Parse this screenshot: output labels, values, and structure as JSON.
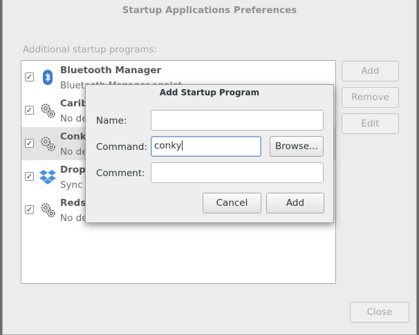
{
  "window": {
    "title": "Startup Applications Preferences",
    "section_label": "Additional startup programs:",
    "buttons": {
      "add": "Add",
      "remove": "Remove",
      "edit": "Edit",
      "close": "Close"
    }
  },
  "programs": [
    {
      "name": "Bluetooth Manager",
      "description": "Bluetooth Manager applet",
      "checked": true,
      "icon": "bluetooth-icon"
    },
    {
      "name": "Caribou",
      "description": "No description",
      "checked": true,
      "icon": "gears-icon"
    },
    {
      "name": "Conky",
      "description": "No description",
      "checked": true,
      "icon": "gears-icon",
      "selected": true
    },
    {
      "name": "Dropbox",
      "description": "Sync your files",
      "checked": true,
      "icon": "dropbox-icon"
    },
    {
      "name": "Redshift",
      "description": "No description",
      "checked": true,
      "icon": "gears-icon"
    }
  ],
  "dialog": {
    "title": "Add Startup Program",
    "name_label": "Name:",
    "command_label": "Command:",
    "comment_label": "Comment:",
    "name_value": "",
    "command_value": "conky",
    "comment_value": "",
    "browse_label": "Browse...",
    "cancel_label": "Cancel",
    "add_label": "Add"
  },
  "colors": {
    "window_bg": "#ececec",
    "focus_ring": "#79a2d1",
    "bluetooth_blue": "#3a7ad0",
    "dropbox_blue": "#4a90d9"
  }
}
